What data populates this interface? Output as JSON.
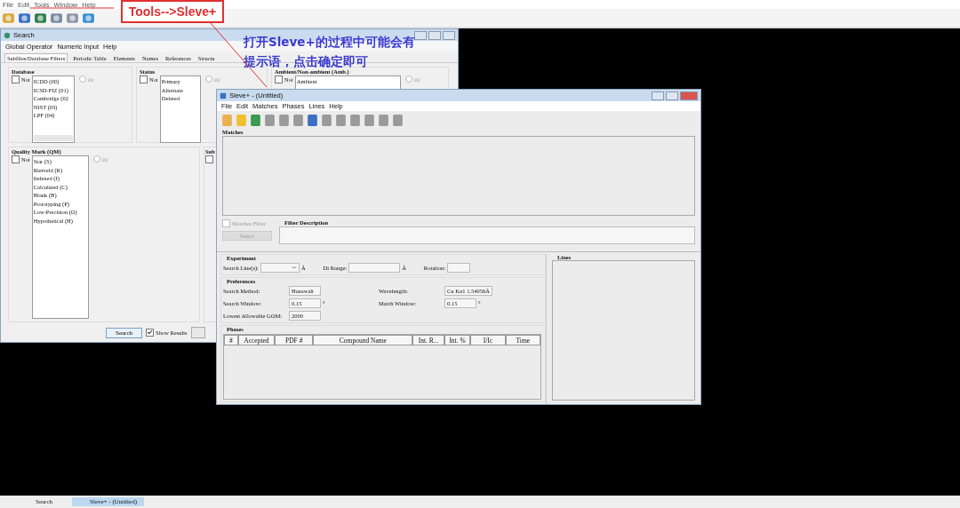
{
  "app": {
    "menu": [
      "File",
      "Edit",
      "Tools",
      "Window",
      "Help"
    ]
  },
  "annotation": {
    "label": "Tools-->Sleve+",
    "note": [
      "打开Sleve+的过程中可能会有",
      "提示语，点击确定即可"
    ]
  },
  "search_window": {
    "title": "Search",
    "menu": [
      "Global Operator",
      "Numeric Input",
      "Help"
    ],
    "tabs": [
      {
        "label": "Subfiles/Database Filters",
        "selected": true
      },
      {
        "label": "Periodic Table",
        "selected": false
      },
      {
        "label": "Elements",
        "selected": false
      },
      {
        "label": "Names",
        "selected": false
      },
      {
        "label": "References",
        "selected": false
      },
      {
        "label": "Structu",
        "selected": false
      }
    ],
    "top_groups": [
      {
        "title": "Database",
        "not_label": "Not",
        "not_checked": false,
        "items": [
          "ICDD (00)",
          "ICSD-FIZ (01)",
          "Cambridge (02",
          "NIST (03)",
          "LPF (04)"
        ],
        "scrollbar": true,
        "or_label": "Or",
        "or_selected": false
      },
      {
        "title": "Status",
        "not_label": "Not",
        "not_checked": false,
        "items": [
          "Primary",
          "Alternate",
          "Deleted"
        ],
        "or_label": "Or",
        "or_selected": false
      },
      {
        "title": "Ambient/Non-ambient (Amb.)",
        "not_label": "Not",
        "not_checked": false,
        "items": [
          "Ambient"
        ],
        "or_label": "Or",
        "or_selected": false
      }
    ],
    "bottom_groups": [
      {
        "title": "Quality Mark (QM)",
        "not_label": "Not",
        "not_checked": false,
        "items": [
          "Star (S)",
          "Rietveld (R)",
          "Indexed (I)",
          "Calculated (C)",
          "Blank (B)",
          "Prototyping (P)",
          "Low-Precision (O)",
          "Hypothetical (H)"
        ],
        "or_label": "Or",
        "or_selected": false
      },
      {
        "title": "Sub",
        "not_checked": false
      }
    ],
    "search_button": "Search",
    "show_results": {
      "label": "Show Results",
      "checked": true
    }
  },
  "sleve_window": {
    "title": "Sleve+ - (Untitled)",
    "menu": [
      "File",
      "Edit",
      "Matches",
      "Phases",
      "Lines",
      "Help"
    ],
    "toolbar": [
      {
        "disabled": false
      },
      {
        "disabled": false
      },
      {
        "disabled": false
      },
      {
        "disabled": true
      },
      {
        "disabled": true
      },
      {
        "disabled": true
      },
      {
        "disabled": false
      },
      {
        "disabled": true
      },
      {
        "disabled": true
      },
      {
        "disabled": true
      },
      {
        "disabled": true
      },
      {
        "disabled": true
      },
      {
        "disabled": true
      }
    ],
    "matches_title": "Matches",
    "filter": {
      "label": "Matches Filter",
      "checked": false,
      "disabled": true,
      "description_title": "Filter Description",
      "select_button": "Select",
      "select_disabled": true
    },
    "experiment": {
      "title": "Experiment",
      "fields": [
        {
          "label": "Search Line(s):",
          "kind": "select",
          "unit": "Å"
        },
        {
          "label": "Di Range:",
          "kind": "field",
          "unit": "Å"
        },
        {
          "label": "Rotation:",
          "kind": "field"
        }
      ]
    },
    "preferences": {
      "title": "Preferences",
      "fields": [
        {
          "label": "Search Method:",
          "value": "Hanawalt"
        },
        {
          "label": "Wavelength:",
          "value": "Cu Kα1 1.54056Å"
        },
        {
          "label": "Search Window:",
          "value": "0.15",
          "unit": "°"
        },
        {
          "label": "Match Window:",
          "value": "0.15",
          "unit": "°"
        },
        {
          "label": "Lowest Allowable GOM:",
          "value": "2000"
        }
      ]
    },
    "phases": {
      "title": "Phases",
      "columns": [
        "#",
        "Accepted",
        "PDF #",
        "Compound Name",
        "Int. R...",
        "Int. %",
        "I/Ic",
        "Time"
      ]
    },
    "lines_title": "Lines"
  },
  "taskbar": [
    {
      "label": "Search",
      "selected": false
    },
    {
      "label": "Sleve+ - (Untitled)",
      "selected": true
    }
  ]
}
